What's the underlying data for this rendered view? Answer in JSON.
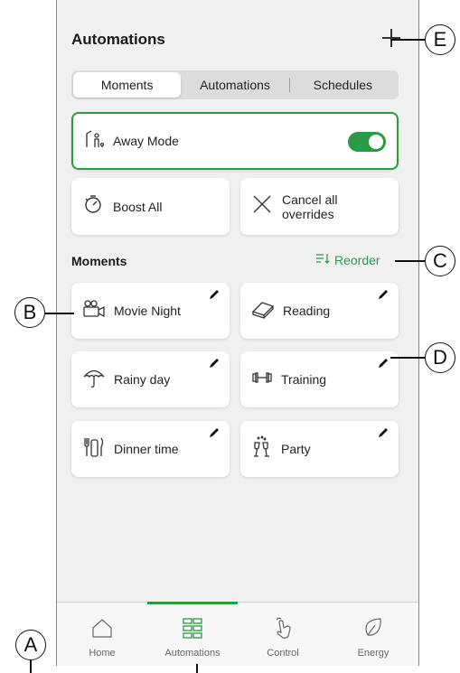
{
  "header": {
    "title": "Automations"
  },
  "segments": [
    "Moments",
    "Automations",
    "Schedules"
  ],
  "away_mode": {
    "label": "Away Mode",
    "enabled": true
  },
  "boost": {
    "label": "Boost All"
  },
  "cancel": {
    "label_line1": "Cancel all",
    "label_line2": "overrides"
  },
  "moments": {
    "section_title": "Moments",
    "reorder_label": "Reorder",
    "items": [
      {
        "label": "Movie Night",
        "icon": "movie-camera-icon"
      },
      {
        "label": "Reading",
        "icon": "book-icon"
      },
      {
        "label": "Rainy day",
        "icon": "umbrella-icon"
      },
      {
        "label": "Training",
        "icon": "dumbbell-icon"
      },
      {
        "label": "Dinner time",
        "icon": "dining-icon"
      },
      {
        "label": "Party",
        "icon": "champagne-icon"
      }
    ]
  },
  "tabs": [
    {
      "label": "Home",
      "icon": "home-icon"
    },
    {
      "label": "Automations",
      "icon": "grid-icon",
      "active": true
    },
    {
      "label": "Control",
      "icon": "hand-touch-icon"
    },
    {
      "label": "Energy",
      "icon": "leaf-icon"
    }
  ],
  "callouts": [
    "A",
    "B",
    "C",
    "D",
    "E"
  ],
  "colors": {
    "accent": "#2b9a45",
    "background": "#f0f0f0",
    "card": "#ffffff"
  }
}
